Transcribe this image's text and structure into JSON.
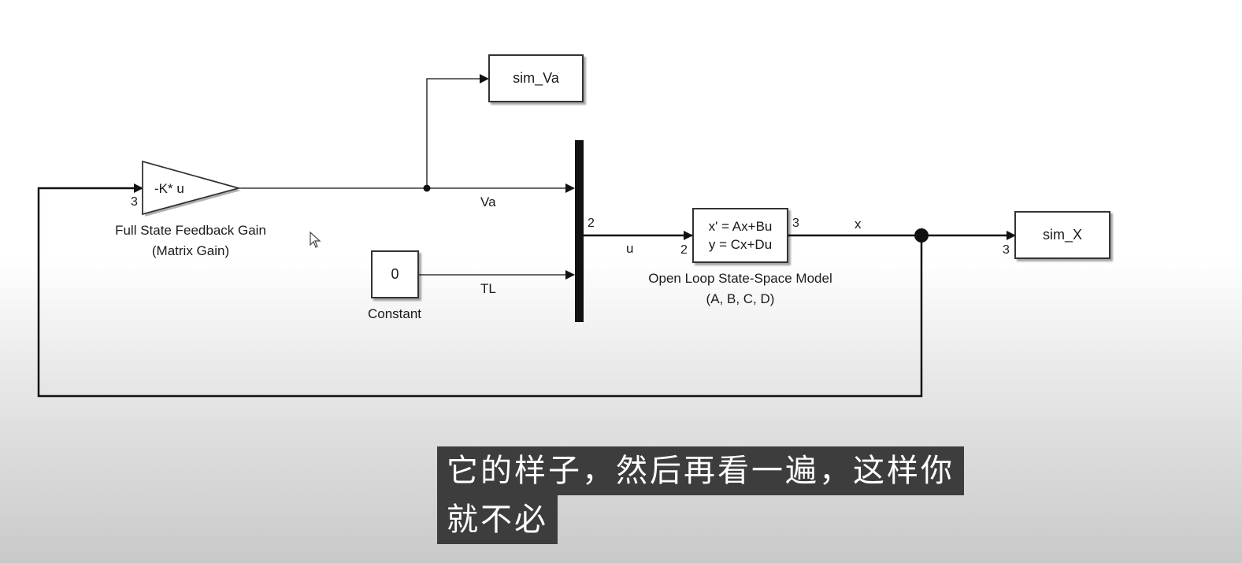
{
  "blocks": {
    "gain": {
      "text": "-K* u",
      "caption_line1": "Full State Feedback Gain",
      "caption_line2": "(Matrix Gain)",
      "in_port": "3"
    },
    "constant": {
      "value": "0",
      "caption": "Constant"
    },
    "state_space": {
      "line1": "x' = Ax+Bu",
      "line2": "y = Cx+Du",
      "caption_line1": "Open Loop State-Space Model",
      "caption_line2": "(A, B, C, D)",
      "in_port": "2",
      "out_port": "3"
    },
    "mux": {
      "out_port": "2"
    },
    "sim_va": {
      "label": "sim_Va"
    },
    "sim_x": {
      "label": "sim_X",
      "in_port": "3"
    }
  },
  "signals": {
    "va": "Va",
    "tl": "TL",
    "u": "u",
    "x": "x"
  },
  "subtitle": {
    "line1": "它的样子，然后再看一遍，这样你",
    "line2": "就不必"
  },
  "colors": {
    "line": "#111111",
    "subtitle_bg": "#3d3d3d"
  }
}
